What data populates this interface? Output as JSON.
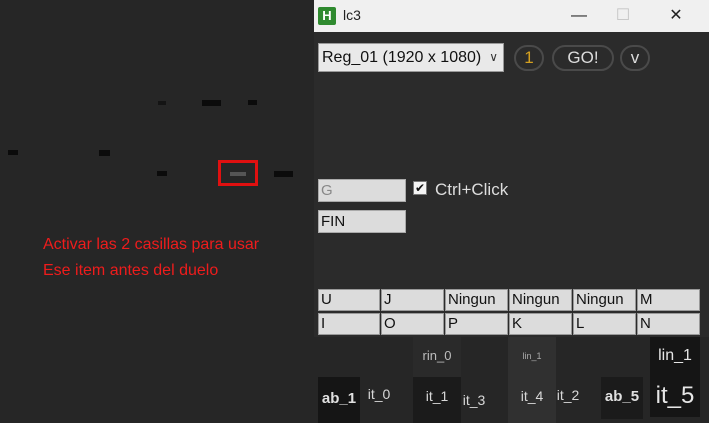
{
  "note": {
    "line1": "Activar  las 2 casillas para usar",
    "line2": "Ese item antes del duelo"
  },
  "window": {
    "title": "lc3",
    "icon_letter": "H",
    "minimize_glyph": "—",
    "maximize_glyph": "☐",
    "close_glyph": "✕"
  },
  "controls": {
    "region_select": "Reg_01 (1920 x 1080)",
    "dropdown_glyph": "∨",
    "counter": "1",
    "go_label": "GO!",
    "v_label": "v"
  },
  "fields": {
    "g_value": "G",
    "check_glyph": "✔",
    "ctrl_click_label": "Ctrl+Click",
    "fin_value": "FIN"
  },
  "grid": {
    "row1": [
      "U",
      "J",
      "Ningun",
      "Ningun",
      "Ningun",
      "M"
    ],
    "row2": [
      "I",
      "O",
      "P",
      "K",
      "L",
      "N"
    ]
  },
  "tiles": {
    "rin_0": "rin_0",
    "lin_1_small": "lin_1",
    "lin_1": "lin_1",
    "ab_1": "ab_1",
    "it_0": "it_0",
    "it_1": "it_1",
    "it_3": "it_3",
    "it_4": "it_4",
    "it_2": "it_2",
    "ab_5": "ab_5",
    "it_5": "it_5"
  },
  "colors": {
    "note_red": "#ee1c1c",
    "counter_gold": "#d4a020",
    "app_icon_green": "#2f8a2f"
  }
}
